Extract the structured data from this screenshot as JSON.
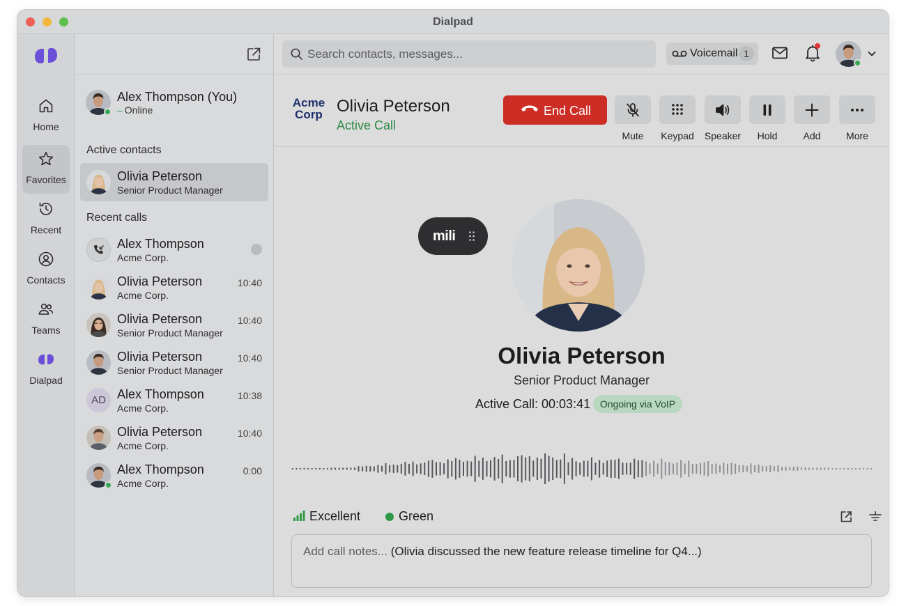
{
  "window": {
    "title": "Dialpad"
  },
  "nav": {
    "items": [
      {
        "label": "Home",
        "icon": "home-icon"
      },
      {
        "label": "Favorites",
        "icon": "star-icon",
        "active": true
      },
      {
        "label": "Recent",
        "icon": "history-icon"
      },
      {
        "label": "Contacts",
        "icon": "contacts-icon"
      },
      {
        "label": "Teams",
        "icon": "teams-icon"
      },
      {
        "label": "Dialpad",
        "icon": "dialpad-logo-icon"
      }
    ]
  },
  "sidebar": {
    "me": {
      "name": "Alex Thompson (You)",
      "status_dash": "–",
      "status": "Online"
    },
    "active_title": "Active contacts",
    "active_contact": {
      "name": "Olivia Peterson",
      "subtitle": "Senior Product Manager"
    },
    "recent_title": "Recent calls",
    "recent": [
      {
        "name": "Alex Thompson",
        "subtitle": "Acme Corp.",
        "time": "",
        "avatar": "call-icon"
      },
      {
        "name": "Olivia Peterson",
        "subtitle": "Acme Corp.",
        "time": "10:40",
        "avatar": "photo"
      },
      {
        "name": "Olivia Peterson",
        "subtitle": "Senior Product Manager",
        "time": "10:40",
        "avatar": "photo"
      },
      {
        "name": "Olivia Peterson",
        "subtitle": "Senior Product Manager",
        "time": "10:40",
        "avatar": "photo"
      },
      {
        "name": "Alex Thompson",
        "subtitle": "Acme Corp.",
        "time": "10:38",
        "avatar": "AD"
      },
      {
        "name": "Olivia Peterson",
        "subtitle": "Acme Corp.",
        "time": "10:40",
        "avatar": "photo"
      },
      {
        "name": "Alex Thompson",
        "subtitle": "Acme Corp.",
        "time": "0:00",
        "avatar": "photo"
      }
    ]
  },
  "topbar": {
    "search_placeholder": "Search contacts, messages...",
    "voicemail_label": "Voicemail",
    "voicemail_count": "1"
  },
  "call": {
    "company_line1": "Acme",
    "company_line2": "Corp",
    "name": "Olivia Peterson",
    "state": "Active Call",
    "end_call_label": "End Call",
    "controls": [
      {
        "label": "Mute",
        "icon": "mic-off-icon"
      },
      {
        "label": "Keypad",
        "icon": "keypad-icon"
      },
      {
        "label": "Speaker",
        "icon": "speaker-icon"
      },
      {
        "label": "Hold",
        "icon": "pause-icon"
      },
      {
        "label": "Add",
        "icon": "plus-icon"
      },
      {
        "label": "More",
        "icon": "more-icon"
      }
    ]
  },
  "stage": {
    "assistant_label": "mili",
    "name": "Olivia Peterson",
    "title": "Senior Product Manager",
    "timer": "Active Call: 00:03:41",
    "badge": "Ongoing via VoIP",
    "quality": "Excellent",
    "quality_color": "Green",
    "notes_placeholder": "Add call notes...",
    "notes_value": "(Olivia discussed the new feature release timeline for Q4...)"
  },
  "colors": {
    "accent_purple": "#6b4fd8",
    "end_call_red": "#cc2e26",
    "online_green": "#34a853",
    "active_call_green": "#2e8b44"
  }
}
